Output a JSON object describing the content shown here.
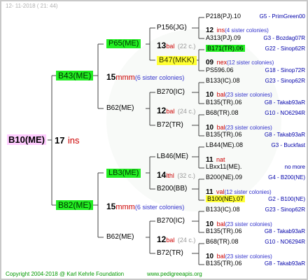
{
  "header": {
    "date": "12- 11-2018 ( 21: 44)"
  },
  "footer": {
    "copyright": "Copyright 2004-2018 @ Karl Kehrle Foundation",
    "site": "www.pedigreeapis.org"
  },
  "gen1": {
    "bee": "B10(ME)",
    "mating_num": "17",
    "mating_label": "ins"
  },
  "gen2": [
    {
      "bee": "B43(ME)",
      "num": "15",
      "mate": "mmm",
      "sisters": "(6 sister colonies)"
    },
    {
      "bee": "B82(ME)",
      "num": "15",
      "mate": "mmm",
      "sisters": "(6 sister colonies)"
    }
  ],
  "gen3": [
    {
      "bee": "P65(ME)",
      "num": "13",
      "mate": "bal",
      "sisters": "(22 c.)"
    },
    {
      "bee": "B62(ME)"
    },
    {
      "bee": "LB3(ME)",
      "num": "14",
      "mate": "lthl",
      "sisters": "(32 c.)"
    },
    {
      "bee": "B62(ME)"
    }
  ],
  "gen4": [
    {
      "bee": "P156(JG)"
    },
    {
      "bee": "B47(MKK)"
    },
    {
      "bee": "B270(IC)",
      "num": "12",
      "mate": "bal",
      "sisters": "(24 c.)"
    },
    {
      "bee": "B72(TR)"
    },
    {
      "bee": "LB46(ME)"
    },
    {
      "bee": "B200(BB)"
    },
    {
      "bee": "B270(IC)",
      "num": "12",
      "mate": "bal",
      "sisters": "(24 c.)"
    },
    {
      "bee": "B72(TR)"
    }
  ],
  "gen5": [
    {
      "type": "bee",
      "text": "P218(PJ).10",
      "right": "G5 - PrimGreen00"
    },
    {
      "type": "mating",
      "num": "12",
      "mate": "ins",
      "sisters": "(4 sister colonies)"
    },
    {
      "type": "bee",
      "text": "A313(PJ).09",
      "right": "G3 - Bozdag07R"
    },
    {
      "type": "bee",
      "text": "B171(TR).06",
      "right": "G22 - Sinop62R",
      "hl": "green"
    },
    {
      "type": "mating",
      "num": "09",
      "mate": "nex",
      "sisters": "(12 sister colonies)"
    },
    {
      "type": "bee",
      "text": "PS596.06",
      "right": "G18 - Sinop72R"
    },
    {
      "type": "bee",
      "text": "B133(IC).08",
      "right": "G23 - Sinop62R"
    },
    {
      "type": "mating",
      "num": "10",
      "mate": "bal",
      "sisters": "(23 sister colonies)"
    },
    {
      "type": "bee",
      "text": "B135(TR).06",
      "right": "G8 - Takab93aR"
    },
    {
      "type": "bee",
      "text": "B68(TR).08",
      "right": "G10 - NO6294R"
    },
    {
      "type": "mating",
      "num": "10",
      "mate": "bal",
      "sisters": "(23 sister colonies)"
    },
    {
      "type": "bee",
      "text": "B135(TR).06",
      "right": "G8 - Takab93aR"
    },
    {
      "type": "bee",
      "text": "LB44(ME).08",
      "right": "G3 - Buckfast"
    },
    {
      "type": "mating",
      "num": "11",
      "mate": "nat",
      "sisters": ""
    },
    {
      "type": "bee",
      "text": "LBxx11(ME).",
      "right": "no more"
    },
    {
      "type": "bee",
      "text": "B200(NE).09",
      "right": "G4 - B200(NE)"
    },
    {
      "type": "mating",
      "num": "11",
      "mate": "val",
      "sisters": "(12 sister colonies)"
    },
    {
      "type": "bee",
      "text": "B100(NE).07",
      "right": "G2 - B100(NE)",
      "hl": "yellow"
    },
    {
      "type": "bee",
      "text": "B133(IC).08",
      "right": "G23 - Sinop62R"
    },
    {
      "type": "mating",
      "num": "10",
      "mate": "bal",
      "sisters": "(23 sister colonies)"
    },
    {
      "type": "bee",
      "text": "B135(TR).06",
      "right": "G8 - Takab93aR"
    },
    {
      "type": "bee",
      "text": "B68(TR).08",
      "right": "G10 - NO6294R"
    },
    {
      "type": "mating",
      "num": "10",
      "mate": "bal",
      "sisters": "(23 sister colonies)"
    },
    {
      "type": "bee",
      "text": "B135(TR).06",
      "right": "G8 - Takab93aR"
    }
  ]
}
